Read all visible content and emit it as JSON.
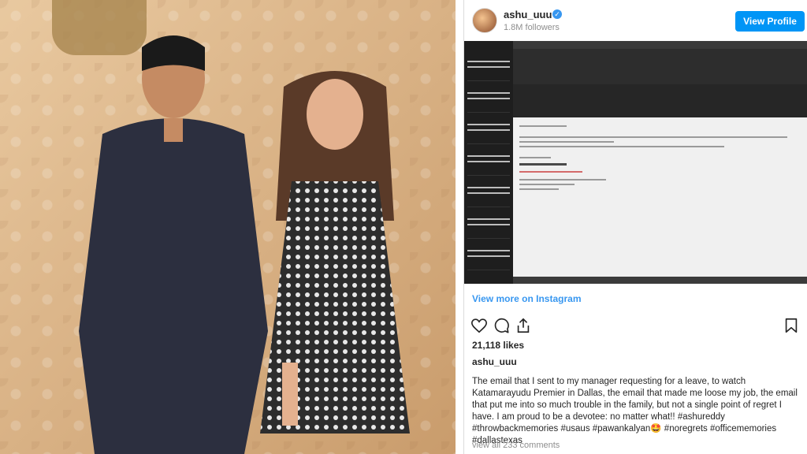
{
  "post": {
    "username": "ashu_uuu",
    "followers": "1.8M followers",
    "view_profile_label": "View Profile",
    "view_more_label": "View more on Instagram",
    "likes": "21,118 likes",
    "caption_user": "ashu_uuu",
    "caption": "The email that I sent to my manager requesting for a leave, to watch Katamarayudu Premier in Dallas, the email that made me loose my job, the email that put me into so much trouble in the family, but not a single point of regret I have. I am proud to be a devotee: no matter what!! #ashureddy #throwbackmemories #usaus #pawankalyan🤩 #noregrets #officememories #dallastexas",
    "view_all_comments": "view all 233 comments"
  },
  "colors": {
    "accent": "#0095f6",
    "link": "#3897f0",
    "text": "#262626",
    "muted": "#8e8e8e"
  },
  "icons": [
    "verified-badge-icon",
    "heart-icon",
    "comment-icon",
    "share-icon",
    "bookmark-icon"
  ]
}
